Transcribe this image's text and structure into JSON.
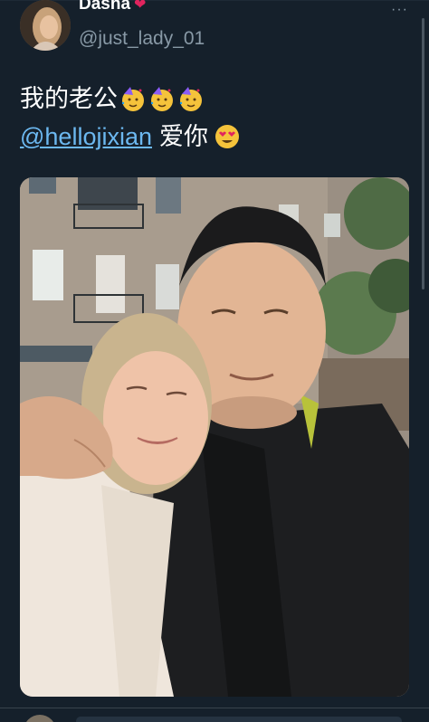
{
  "tweet": {
    "display_name": "Dasha",
    "verified_symbol": "❤",
    "handle": "@just_lady_01",
    "more_label": "···",
    "text_line1": "我的老公",
    "mention": "@hellojixian",
    "text_line2_suffix": "爱你",
    "emoji_line1": [
      "partying-face-emoji",
      "partying-face-emoji",
      "partying-face-emoji"
    ],
    "emoji_line2": "heart-eyes-emoji"
  },
  "photo": {
    "description_icon": "couple-selfie-photo"
  },
  "colors": {
    "background": "#15202b",
    "handle": "#8899a6",
    "mention": "#6cb8f0",
    "heart": "#e0245e"
  }
}
